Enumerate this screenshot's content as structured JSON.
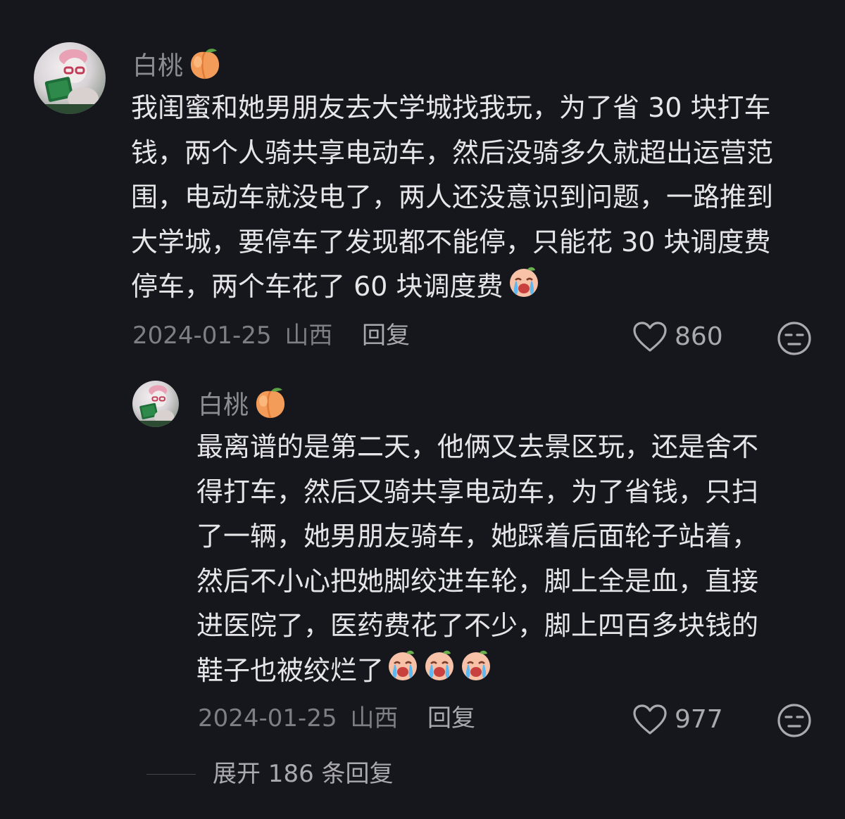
{
  "comment": {
    "username": "白桃",
    "username_emoji": "peach-emoji",
    "lines": [
      "我闺蜜和她男朋友去大学城找我玩，为了省 30 块打车",
      "钱，两个人骑共享电动车，然后没骑多久就超出运营范",
      "围，电动车就没电了，两人还没意识到问题，一路推到",
      "大学城，要停车了发现都不能停，只能花 30 块调度费",
      "停车，两个车花了 60 块调度费"
    ],
    "trailing_emoji": "crying-emoji",
    "date": "2024-01-25",
    "location": "山西",
    "reply_label": "回复",
    "likes": "860"
  },
  "reply": {
    "username": "白桃",
    "username_emoji": "peach-emoji",
    "lines": [
      "最离谱的是第二天，他俩又去景区玩，还是舍不",
      "得打车，然后又骑共享电动车，为了省钱，只扫",
      "了一辆，她男朋友骑车，她踩着后面轮子站着，",
      "然后不小心把她脚绞进车轮，脚上全是血，直接",
      "进医院了，医药费花了不少，脚上四百多块钱的",
      "鞋子也被绞烂了"
    ],
    "trailing_emojis": [
      "crying-emoji",
      "crying-emoji",
      "crying-emoji"
    ],
    "date": "2024-01-25",
    "location": "山西",
    "reply_label": "回复",
    "likes": "977"
  },
  "expand_label": "展开 186 条回复",
  "colors": {
    "background": "#16161d",
    "body_text": "#e6e6e8",
    "muted_text": "#7e7e84",
    "peach": "#f4a468"
  }
}
